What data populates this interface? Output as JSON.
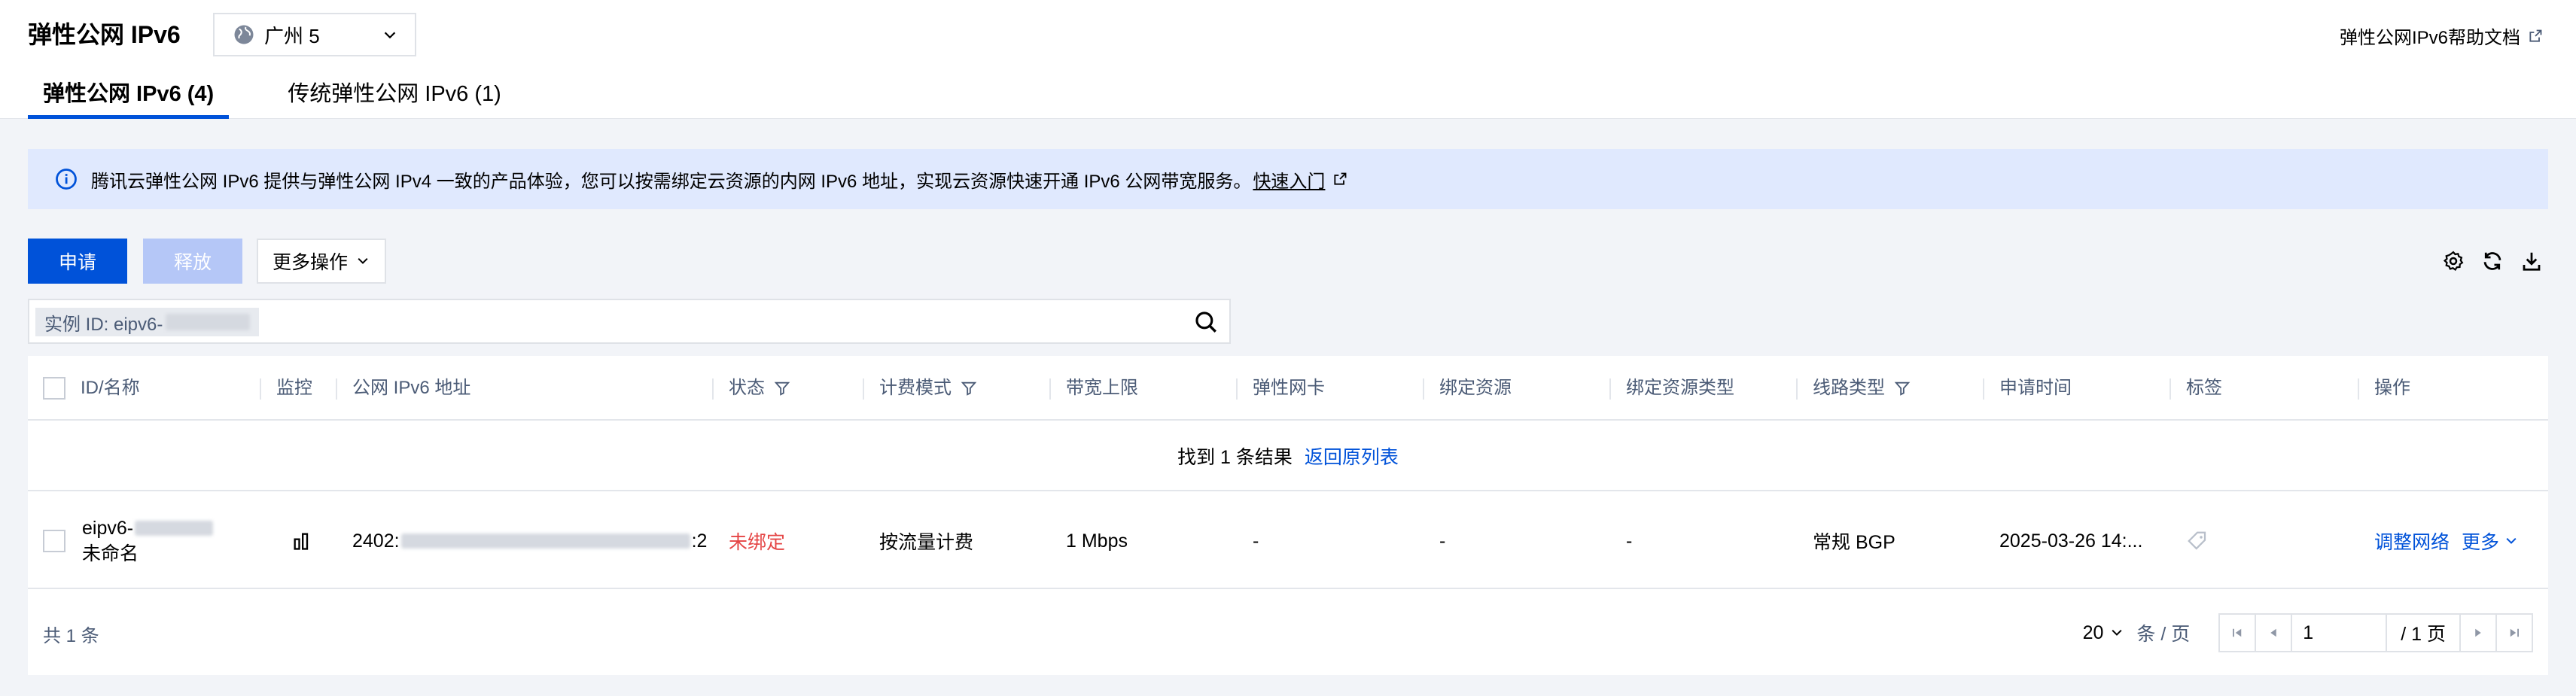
{
  "header": {
    "title": "弹性公网 IPv6",
    "region": "广州 5",
    "help_link": "弹性公网IPv6帮助文档"
  },
  "tabs": [
    {
      "label": "弹性公网 IPv6 (4)",
      "active": true
    },
    {
      "label": "传统弹性公网 IPv6 (1)",
      "active": false
    }
  ],
  "banner": {
    "text": "腾讯云弹性公网 IPv6 提供与弹性公网 IPv4 一致的产品体验，您可以按需绑定云资源的内网 IPv6 地址，实现云资源快速开通 IPv6 公网带宽服务。",
    "link": "快速入门"
  },
  "toolbar": {
    "apply_label": "申请",
    "release_label": "释放",
    "more_label": "更多操作"
  },
  "search": {
    "chip_prefix": "实例 ID: eipv6-"
  },
  "table": {
    "columns": [
      "ID/名称",
      "监控",
      "公网 IPv6 地址",
      "状态",
      "计费模式",
      "带宽上限",
      "弹性网卡",
      "绑定资源",
      "绑定资源类型",
      "线路类型",
      "申请时间",
      "标签",
      "操作"
    ],
    "result_text": "找到 1 条结果",
    "back_link": "返回原列表",
    "rows": [
      {
        "id_prefix": "eipv6-",
        "name": "未命名",
        "ipv6_prefix": "2402:",
        "ipv6_suffix": ":2",
        "status": "未绑定",
        "billing": "按流量计费",
        "bandwidth": "1 Mbps",
        "eni": "-",
        "bound_resource": "-",
        "bound_type": "-",
        "line_type": "常规 BGP",
        "apply_time": "2025-03-26 14:...",
        "op_adjust": "调整网络",
        "op_more": "更多"
      }
    ]
  },
  "footer": {
    "total": "共 1 条",
    "page_size": "20",
    "page_size_unit": "条 / 页",
    "current_page": "1",
    "total_pages": "/ 1 页"
  },
  "colors": {
    "primary": "#0052d9",
    "primary_disabled": "#b5c7f7",
    "banner_bg": "#e0e9fe",
    "danger": "#e54545"
  }
}
